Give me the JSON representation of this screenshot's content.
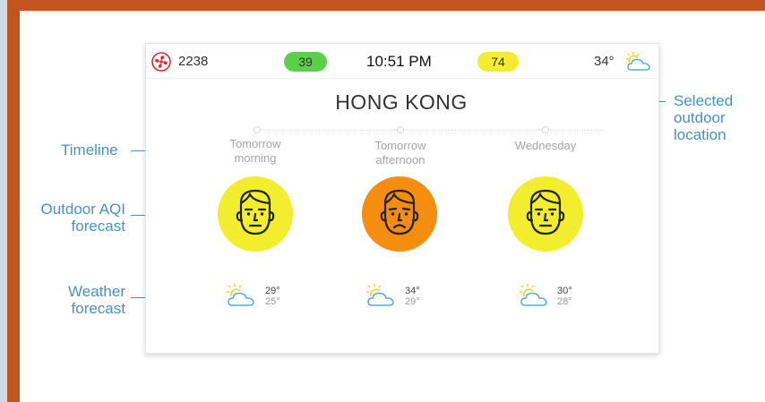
{
  "colors": {
    "frame": "#c2541f",
    "aqi_good": "#f2ee2e",
    "aqi_moderate": "#f58d0e",
    "green_pill": "#5ccf4a",
    "callout": "#4a90c2"
  },
  "status_bar": {
    "fan_icon": "fan-icon",
    "fan_count": "2238",
    "indoor_green_value": "39",
    "time": "10:51 PM",
    "indoor_yellow_value": "74",
    "current_temp": "34°",
    "weather_icon": "partly-cloudy-icon"
  },
  "location": "HONG KONG",
  "forecast": [
    {
      "label_line1": "Tomorrow",
      "label_line2": "morning",
      "aqi_face": "neutral-face-icon",
      "aqi_color": "#f2ee2e",
      "weather_icon": "partly-cloudy-icon",
      "high": "29°",
      "low": "25°"
    },
    {
      "label_line1": "Tomorrow",
      "label_line2": "afternoon",
      "aqi_face": "sad-face-icon",
      "aqi_color": "#f58d0e",
      "weather_icon": "partly-cloudy-icon",
      "high": "34°",
      "low": "29°"
    },
    {
      "label_line1": "Wednesday",
      "label_line2": "",
      "aqi_face": "neutral-face-icon",
      "aqi_color": "#f2ee2e",
      "weather_icon": "partly-cloudy-icon",
      "high": "30°",
      "low": "28°"
    }
  ],
  "callouts": {
    "timeline": "Timeline",
    "aqi_line1": "Outdoor AQI",
    "aqi_line2": "forecast",
    "weather_line1": "Weather",
    "weather_line2": "forecast",
    "location_line1": "Selected",
    "location_line2": "outdoor",
    "location_line3": "location"
  }
}
